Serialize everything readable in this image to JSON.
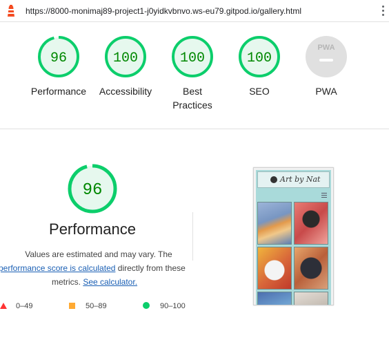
{
  "address_bar": {
    "url": "https://8000-monimaj89-project1-j0yidkvbnvo.ws-eu79.gitpod.io/gallery.html"
  },
  "categories": [
    {
      "id": "performance",
      "score": "96",
      "label": "Performance",
      "status": "pass"
    },
    {
      "id": "accessibility",
      "score": "100",
      "label": "Accessibility",
      "status": "pass"
    },
    {
      "id": "best-practices",
      "score": "100",
      "label": "Best Practices",
      "status": "pass"
    },
    {
      "id": "seo",
      "score": "100",
      "label": "SEO",
      "status": "pass"
    },
    {
      "id": "pwa",
      "score": "",
      "badge": "PWA",
      "label": "PWA",
      "status": "na"
    }
  ],
  "performance_section": {
    "score": "96",
    "title": "Performance",
    "description_prefix": "Values are estimated and may vary. The",
    "link_score": "performance score is calculated",
    "description_middle": "directly from these",
    "description_metrics": "metrics.",
    "link_calculator": "See calculator."
  },
  "legend": [
    {
      "shape": "triangle",
      "range": "0–49",
      "color": "#ff3333"
    },
    {
      "shape": "square",
      "range": "50–89",
      "color": "#ffaa33"
    },
    {
      "shape": "circle",
      "range": "90–100",
      "color": "#0cce6b"
    }
  ],
  "screenshot": {
    "brand": "Art by Nat"
  },
  "colors": {
    "pass_ring": "#0cce6b",
    "pass_fill": "#e6f8ee",
    "pass_text": "#008800",
    "na_gray": "#e0e0e0",
    "link": "#1a5fb4"
  }
}
